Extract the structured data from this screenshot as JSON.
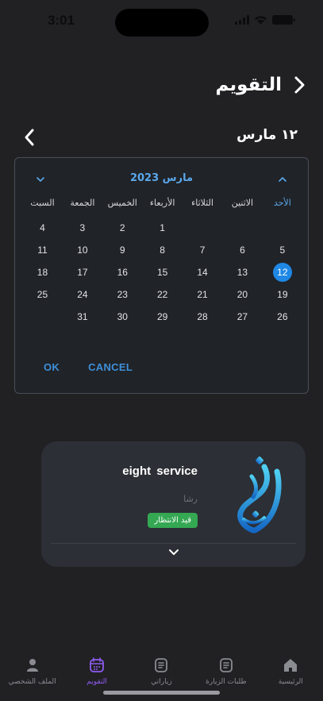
{
  "status_bar": {
    "time": "3:01"
  },
  "header": {
    "title": "التقويم"
  },
  "date_selector": {
    "label": "١٢ مارس"
  },
  "calendar": {
    "month_label": "مارس 2023",
    "weekdays": [
      "الأحد",
      "الاثنين",
      "الثلاثاء",
      "الأربعاء",
      "الخميس",
      "الجمعة",
      "السبت"
    ],
    "days": [
      "",
      "",
      "",
      "1",
      "2",
      "3",
      "4",
      "5",
      "6",
      "7",
      "8",
      "9",
      "10",
      "11",
      "12",
      "13",
      "14",
      "15",
      "16",
      "17",
      "18",
      "19",
      "20",
      "21",
      "22",
      "23",
      "24",
      "25",
      "26",
      "27",
      "28",
      "29",
      "30",
      "31",
      ""
    ],
    "selected_day": "12",
    "ok_label": "OK",
    "cancel_label": "CANCEL"
  },
  "visit_card": {
    "title": "eight  service",
    "subtitle": "رشا",
    "status": "قيد الانتظار"
  },
  "tabbar": {
    "items": [
      {
        "label": "الرئيسية",
        "icon": "home-icon"
      },
      {
        "label": "طلبات الزيارة",
        "icon": "list-icon"
      },
      {
        "label": "زياراتي",
        "icon": "list-icon"
      },
      {
        "label": "التقويم",
        "icon": "calendar-icon",
        "active": true
      },
      {
        "label": "الملف الشخصي",
        "icon": "user-icon"
      }
    ]
  },
  "colors": {
    "background": "#212124",
    "accent_blue": "#1f88e5",
    "active_tab": "#8e5bf0",
    "status_green": "#34a852"
  }
}
